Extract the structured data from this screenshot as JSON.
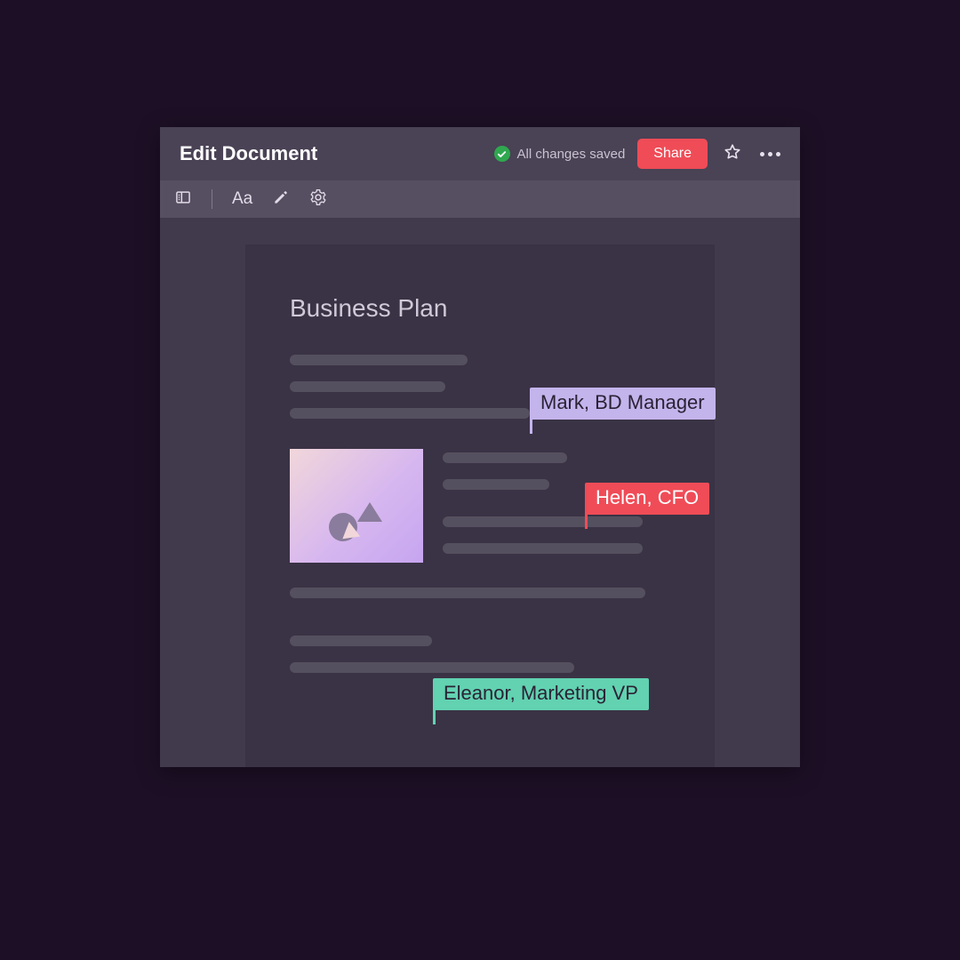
{
  "header": {
    "title": "Edit Document",
    "save_status": "All changes saved",
    "share_label": "Share"
  },
  "toolbar": {
    "typography_label": "Aa"
  },
  "document": {
    "title": "Business Plan"
  },
  "cursors": [
    {
      "label": "Mark, BD Manager",
      "color": "purple"
    },
    {
      "label": "Helen, CFO",
      "color": "red"
    },
    {
      "label": "Eleanor, Marketing VP",
      "color": "teal"
    }
  ],
  "colors": {
    "accent_red": "#ef4c57",
    "accent_purple": "#c4b4ec",
    "accent_teal": "#62d2b1",
    "save_green": "#2fa84f"
  }
}
